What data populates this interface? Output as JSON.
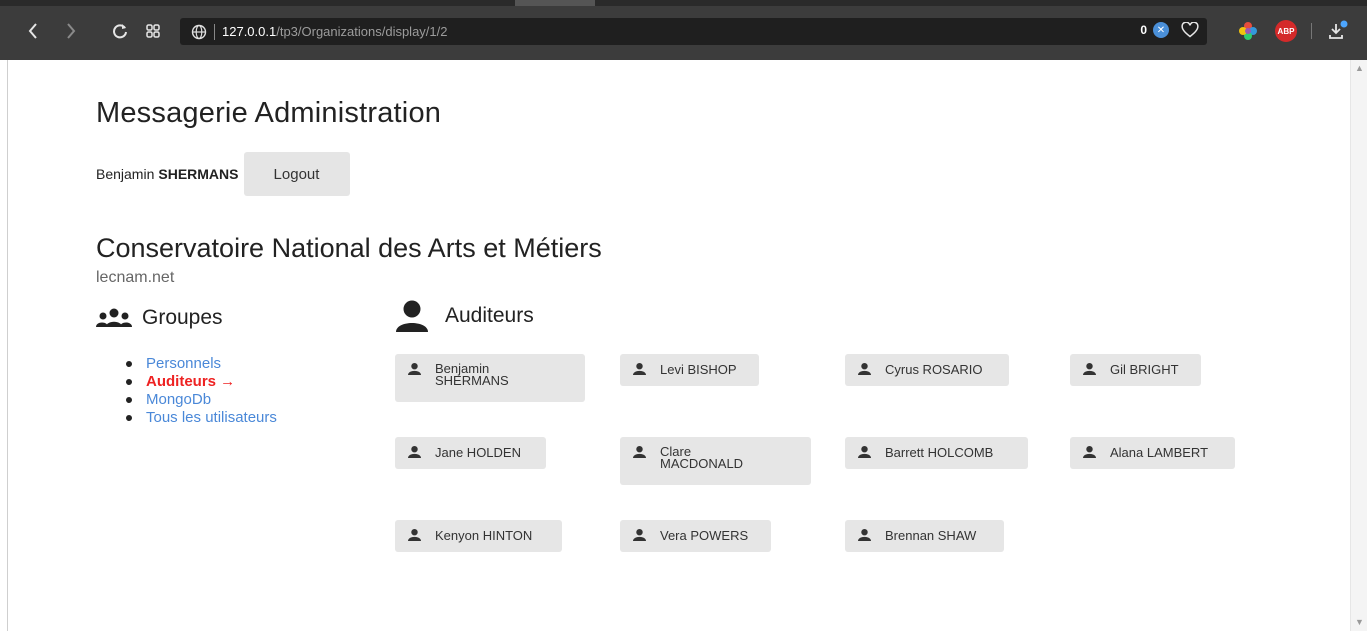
{
  "browser": {
    "url_host": "127.0.0.1",
    "url_path": "/tp3/Organizations/display/1/2",
    "tracker_count": "0",
    "adblock_label": "ABP"
  },
  "header": {
    "app_title": "Messagerie Administration",
    "user_first_name": "Benjamin",
    "user_last_name": "SHERMANS",
    "logout_label": "Logout"
  },
  "organization": {
    "name": "Conservatoire National des Arts et Métiers",
    "domain": "lecnam.net"
  },
  "groups": {
    "title": "Groupes",
    "items": [
      {
        "label": "Personnels",
        "active": false
      },
      {
        "label": "Auditeurs →",
        "active": true
      },
      {
        "label": "MongoDb",
        "active": false
      },
      {
        "label": "Tous les utilisateurs",
        "active": false
      }
    ]
  },
  "members": {
    "title": "Auditeurs",
    "items": [
      {
        "name": "Benjamin SHERMANS"
      },
      {
        "name": "Levi BISHOP"
      },
      {
        "name": "Cyrus ROSARIO"
      },
      {
        "name": "Gil BRIGHT"
      },
      {
        "name": "Jane HOLDEN"
      },
      {
        "name": "Clare MACDONALD"
      },
      {
        "name": "Barrett HOLCOMB"
      },
      {
        "name": "Alana LAMBERT"
      },
      {
        "name": "Kenyon HINTON"
      },
      {
        "name": "Vera POWERS"
      },
      {
        "name": "Brennan SHAW"
      }
    ]
  },
  "colors": {
    "link": "#4a88d8",
    "active_link": "#ee2222",
    "card_bg": "#e6e6e6",
    "toolbar_bg": "#3c3c3c"
  }
}
